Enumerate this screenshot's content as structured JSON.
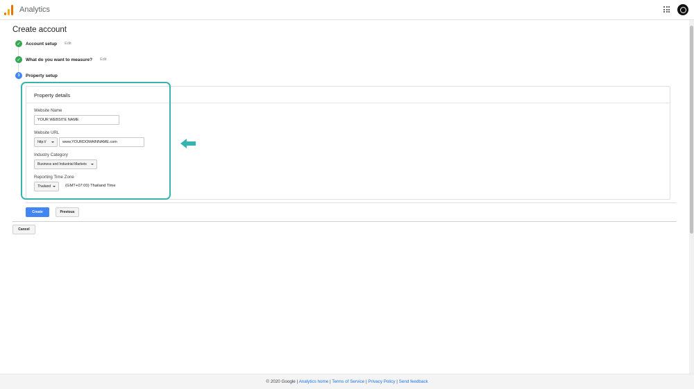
{
  "app": {
    "title": "Analytics"
  },
  "page": {
    "title": "Create account"
  },
  "steps": [
    {
      "label": "Account setup",
      "edit": "Edit",
      "status": "done"
    },
    {
      "label": "What do you want to measure?",
      "edit": "Edit",
      "status": "done"
    },
    {
      "label": "Property setup",
      "number": "3",
      "status": "current"
    }
  ],
  "property_details": {
    "title": "Property details",
    "website_name": {
      "label": "Website Name",
      "value": "YOUR WEBSITE NAME"
    },
    "website_url": {
      "label": "Website URL",
      "protocol": "http://",
      "value": "www.YOURDOMAINNAME.com"
    },
    "industry": {
      "label": "Industry Category",
      "value": "Business and Industrial Markets"
    },
    "timezone": {
      "label": "Reporting Time Zone",
      "country": "Thailand",
      "zone": "(GMT+07:00) Thailand Time"
    }
  },
  "actions": {
    "create": "Create",
    "previous": "Previous",
    "cancel": "Cancel"
  },
  "footer": {
    "copyright": "© 2020 Google",
    "sep": "|",
    "links": [
      "Analytics home",
      "Terms of Service",
      "Privacy Policy",
      "Send feedback"
    ]
  },
  "colors": {
    "accent": "#4285f4",
    "done": "#34a853",
    "highlight": "#36b3b0"
  },
  "icons": {
    "logo": "analytics-logo-icon",
    "apps": "apps-grid-icon",
    "arrow": "left-arrow-icon"
  }
}
